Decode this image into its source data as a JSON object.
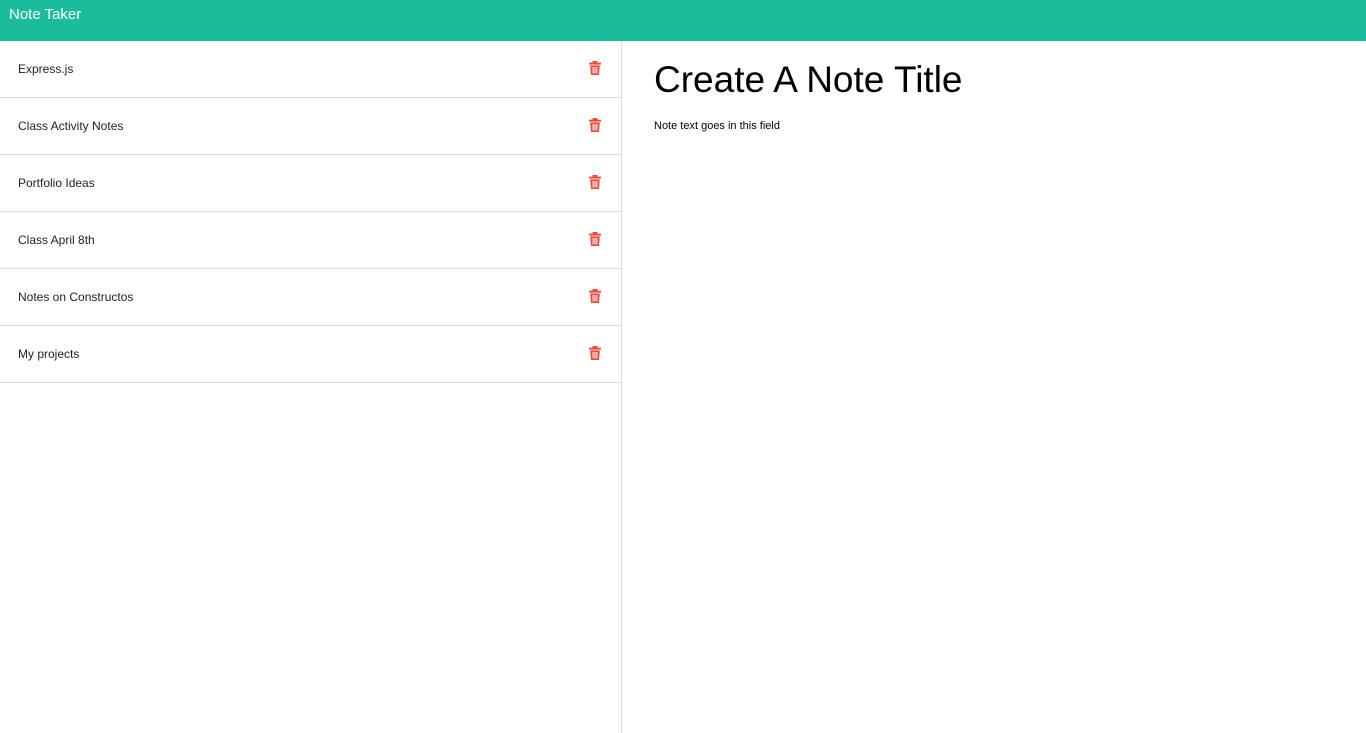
{
  "app": {
    "brand": "Note Taker"
  },
  "colors": {
    "navbar": "#1abc9c",
    "delete_icon": "#e74c3c"
  },
  "sidebar": {
    "notes": [
      {
        "title": "Express.js",
        "icon": "trash-icon"
      },
      {
        "title": "Class Activity Notes",
        "icon": "trash-icon"
      },
      {
        "title": "Portfolio Ideas",
        "icon": "trash-icon"
      },
      {
        "title": "Class April 8th",
        "icon": "trash-icon"
      },
      {
        "title": "Notes on Constructos",
        "icon": "trash-icon"
      },
      {
        "title": "My projects",
        "icon": "trash-icon"
      }
    ]
  },
  "editor": {
    "title_placeholder": "Create A Note Title",
    "title_value": "",
    "text_placeholder": "Note text goes in this field",
    "text_value": ""
  }
}
